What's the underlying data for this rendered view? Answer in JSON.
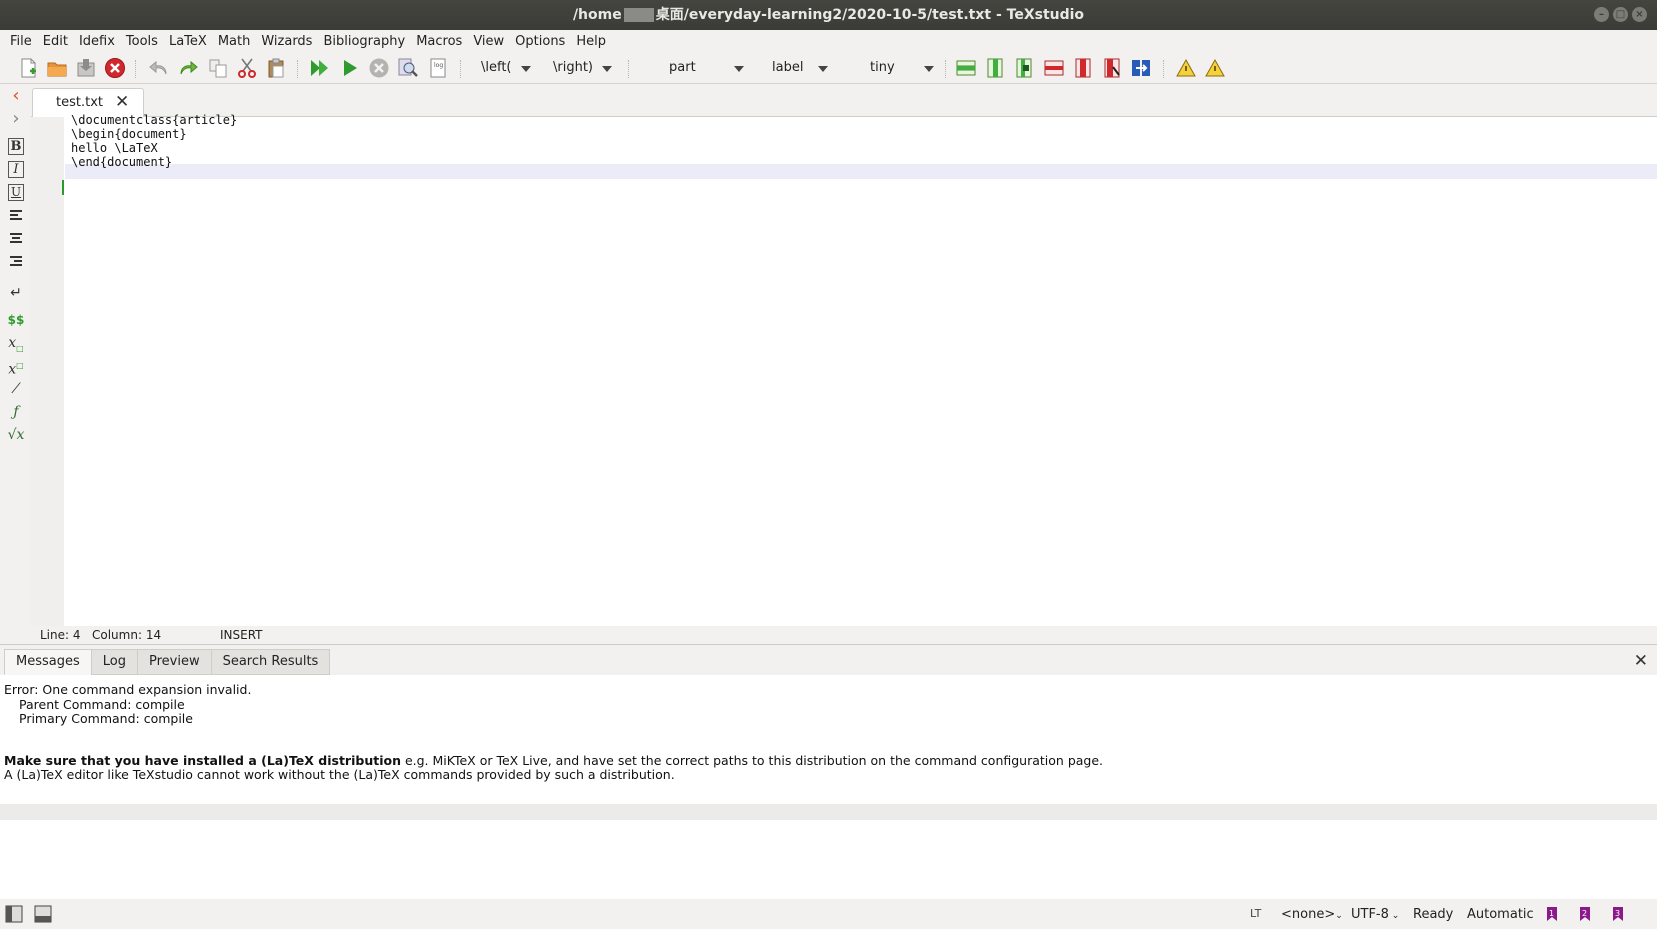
{
  "window": {
    "title_prefix": "/home",
    "title_suffix": "桌面/everyday-learning2/2020-10-5/test.txt - TeXstudio"
  },
  "menu": [
    "File",
    "Edit",
    "Idefix",
    "Tools",
    "LaTeX",
    "Math",
    "Wizards",
    "Bibliography",
    "Macros",
    "View",
    "Options",
    "Help"
  ],
  "toolbar": {
    "left_combo": "\\left(",
    "right_combo": "\\right)",
    "section_combo": "part",
    "ref_combo": "label",
    "size_combo": "tiny"
  },
  "tabs": {
    "file": "test.txt"
  },
  "editor": {
    "lines": [
      "\\documentclass{article}",
      "\\begin{document}",
      "hello \\LaTeX",
      "\\end{document}"
    ]
  },
  "editor_status": {
    "line": "Line: 4",
    "column": "Column: 14",
    "mode": "INSERT"
  },
  "panel": {
    "tabs": [
      "Messages",
      "Log",
      "Preview",
      "Search Results"
    ],
    "messages": {
      "error": "Error: One command expansion invalid.",
      "parent": "Parent Command: compile",
      "primary": "Primary Command: compile",
      "bold": "Make sure that you have installed a (La)TeX distribution",
      "rest": " e.g. MiKTeX or TeX Live, and have set the correct paths to this distribution on the command configuration page.",
      "line2": "A (La)TeX editor like TeXstudio cannot work without the (La)TeX commands provided by such a distribution."
    }
  },
  "statusbar": {
    "lt": "LT",
    "language": "<none>",
    "encoding": "UTF-8",
    "state": "Ready",
    "mode": "Automatic"
  },
  "colors": {
    "accent_green": "#2a9a2a",
    "error_red": "#d0282c",
    "purple": "#8a1a8a"
  }
}
